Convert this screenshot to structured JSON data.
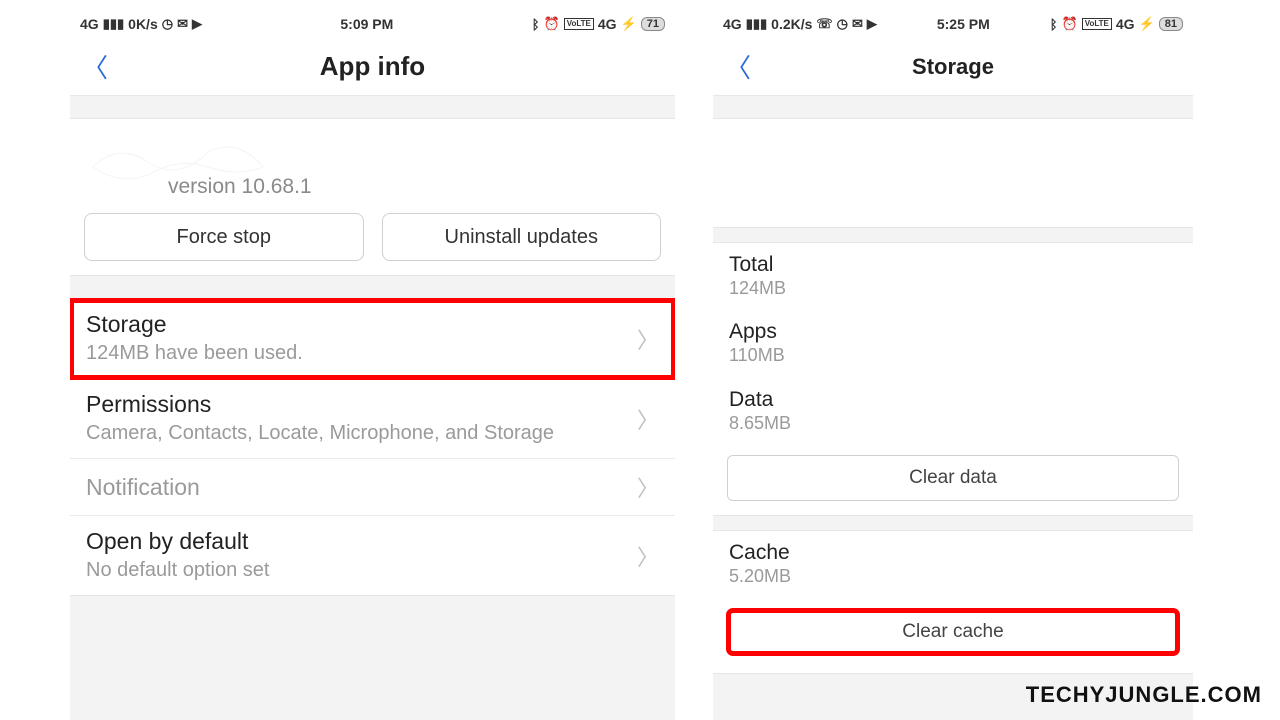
{
  "watermark": "TECHYJUNGLE.COM",
  "left": {
    "status": {
      "network": "4G",
      "speed": "0K/s",
      "time": "5:09 PM",
      "battery": "71"
    },
    "header_title": "App info",
    "version": "version 10.68.1",
    "force_stop": "Force stop",
    "uninstall": "Uninstall updates",
    "rows": {
      "storage_title": "Storage",
      "storage_sub": "124MB have been used.",
      "perm_title": "Permissions",
      "perm_sub": "Camera, Contacts, Locate, Microphone, and Storage",
      "notif_title": "Notification",
      "open_title": "Open by default",
      "open_sub": "No default option set"
    }
  },
  "right": {
    "status": {
      "network": "4G",
      "speed": "0.2K/s",
      "time": "5:25 PM",
      "battery": "81"
    },
    "header_title": "Storage",
    "total_label": "Total",
    "total_val": "124MB",
    "apps_label": "Apps",
    "apps_val": "110MB",
    "data_label": "Data",
    "data_val": "8.65MB",
    "clear_data": "Clear data",
    "cache_label": "Cache",
    "cache_val": "5.20MB",
    "clear_cache": "Clear cache"
  }
}
